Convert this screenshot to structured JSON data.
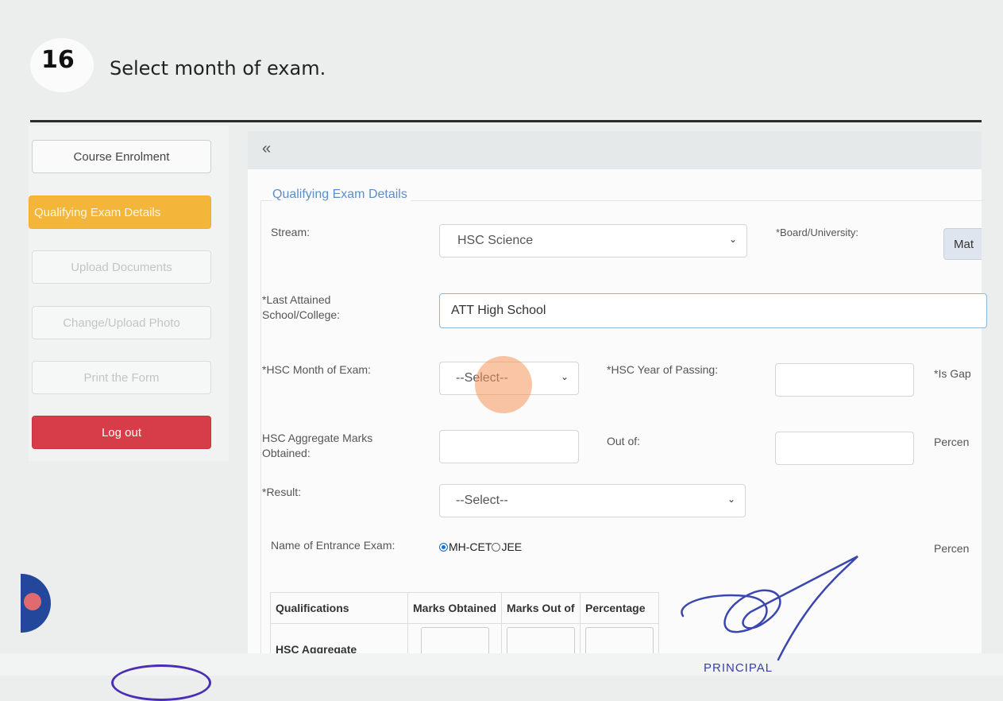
{
  "instruction": {
    "step_number": "16",
    "text": "Select month of exam."
  },
  "sidebar": {
    "items": [
      {
        "label": "Course Enrolment"
      },
      {
        "label": "Qualifying Exam Details"
      },
      {
        "label": "Upload Documents"
      },
      {
        "label": "Change/Upload Photo"
      },
      {
        "label": "Print the Form"
      },
      {
        "label": "Log out"
      }
    ]
  },
  "header": {
    "collapse_icon": "«"
  },
  "form": {
    "legend": "Qualifying Exam Details",
    "stream_label": "Stream:",
    "stream_value": "HSC Science",
    "board_label": "*Board/University:",
    "board_value": "Mat",
    "school_label": "*Last Attained School/College:",
    "school_value": "ATT High School",
    "month_label": "*HSC Month of Exam:",
    "month_value": "--Select--",
    "year_label": "*HSC Year of Passing:",
    "gap_label": "*Is Gap",
    "marks_label": "HSC Aggregate Marks Obtained:",
    "outof_label": "Out of:",
    "percent_label": "Percen",
    "result_label": "*Result:",
    "result_value": "--Select--",
    "entrance_label": "Name of Entrance Exam:",
    "entrance_options": [
      "MH-CET",
      "JEE"
    ],
    "entrance_selected": "MH-CET",
    "percent_label_2": "Percen"
  },
  "table": {
    "headers": [
      "Qualifications",
      "Marks Obtained",
      "Marks Out of",
      "Percentage"
    ],
    "row_label": "HSC Aggregate"
  },
  "footer": {
    "principal": "PRINCIPAL"
  },
  "colors": {
    "active": "#f4b63a",
    "logout": "#d63d48",
    "legend": "#5c8fc9",
    "highlight": "#f5965a"
  }
}
